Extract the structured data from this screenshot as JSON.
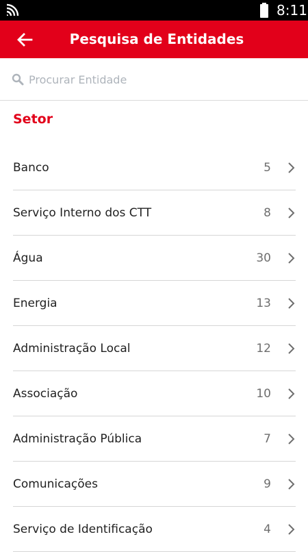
{
  "status_bar": {
    "time": "8:11",
    "icons": [
      "wifi-icon",
      "battery-icon"
    ]
  },
  "app_bar": {
    "title": "Pesquisa de Entidades",
    "back_icon": "back-arrow-icon",
    "color": "#e2001a"
  },
  "search": {
    "placeholder": "Procurar Entidade",
    "value": "",
    "icon": "search-icon"
  },
  "section": {
    "title": "Setor"
  },
  "sectors": [
    {
      "label": "Banco",
      "count": "5"
    },
    {
      "label": "Serviço Interno dos CTT",
      "count": "8"
    },
    {
      "label": "Água",
      "count": "30"
    },
    {
      "label": "Energia",
      "count": "13"
    },
    {
      "label": "Administração Local",
      "count": "12"
    },
    {
      "label": "Associação",
      "count": "10"
    },
    {
      "label": "Administração Pública",
      "count": "7"
    },
    {
      "label": "Comunicações",
      "count": "9"
    },
    {
      "label": "Serviço de Identificação",
      "count": "4"
    }
  ]
}
